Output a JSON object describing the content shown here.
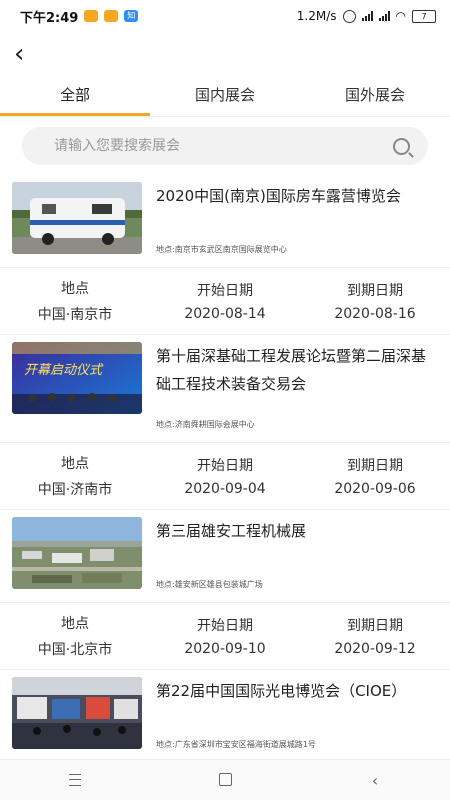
{
  "status": {
    "time": "下午2:49",
    "speed": "1.2M/s",
    "battery": "7"
  },
  "tabs": [
    {
      "label": "全部"
    },
    {
      "label": "国内展会"
    },
    {
      "label": "国外展会"
    }
  ],
  "search": {
    "placeholder": "请输入您要搜索展会"
  },
  "columns": {
    "location": "地点",
    "start": "开始日期",
    "end": "到期日期"
  },
  "expos": [
    {
      "title": "2020中国(南京)国际房车露营博览会",
      "address": "地点:南京市玄武区南京国际展览中心",
      "location": "中国·南京市",
      "start": "2020-08-14",
      "end": "2020-08-16"
    },
    {
      "title": "第十届深基础工程发展论坛暨第二届深基础工程技术装备交易会",
      "address": "地点:济南舜耕国际会展中心",
      "location": "中国·济南市",
      "start": "2020-09-04",
      "end": "2020-09-06",
      "image_text": "开幕启动仪式"
    },
    {
      "title": "第三届雄安工程机械展",
      "address": "地点:雄安新区雄县包装城广场",
      "location": "中国·北京市",
      "start": "2020-09-10",
      "end": "2020-09-12"
    },
    {
      "title": "第22届中国国际光电博览会（CIOE）",
      "address": "地点:广东省深圳市宝安区福海街道展城路1号"
    }
  ]
}
